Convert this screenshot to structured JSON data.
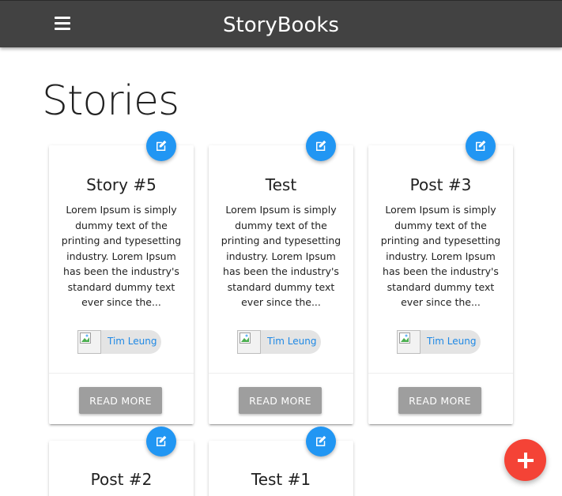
{
  "navbar": {
    "brand": "StoryBooks",
    "menu_icon": "hamburger-menu-icon"
  },
  "page": {
    "title": "Stories"
  },
  "stories": [
    {
      "title": "Story #5",
      "excerpt": "Lorem Ipsum is simply dummy text of the printing and typesetting industry. Lorem Ipsum has been the industry's standard dummy text ever since the...",
      "author": "Tim Leung",
      "action_label": "Read More",
      "edit_icon": "edit-icon"
    },
    {
      "title": "Test",
      "excerpt": "Lorem Ipsum is simply dummy text of the printing and typesetting industry. Lorem Ipsum has been the industry's standard dummy text ever since the...",
      "author": "Tim Leung",
      "action_label": "Read More",
      "edit_icon": "edit-icon"
    },
    {
      "title": "Post #3",
      "excerpt": "Lorem Ipsum is simply dummy text of the printing and typesetting industry. Lorem Ipsum has been the industry's standard dummy text ever since the...",
      "author": "Tim Leung",
      "action_label": "Read More",
      "edit_icon": "edit-icon"
    },
    {
      "title": "Post #2",
      "edit_icon": "edit-icon"
    },
    {
      "title": "Test #1",
      "edit_icon": "edit-icon"
    }
  ],
  "fab": {
    "icon": "add-icon"
  },
  "colors": {
    "navbar": "#424242",
    "edit_fab": "#2196f3",
    "add_fab": "#f44336",
    "author_link": "#1e88e5",
    "button": "#9e9e9e"
  }
}
